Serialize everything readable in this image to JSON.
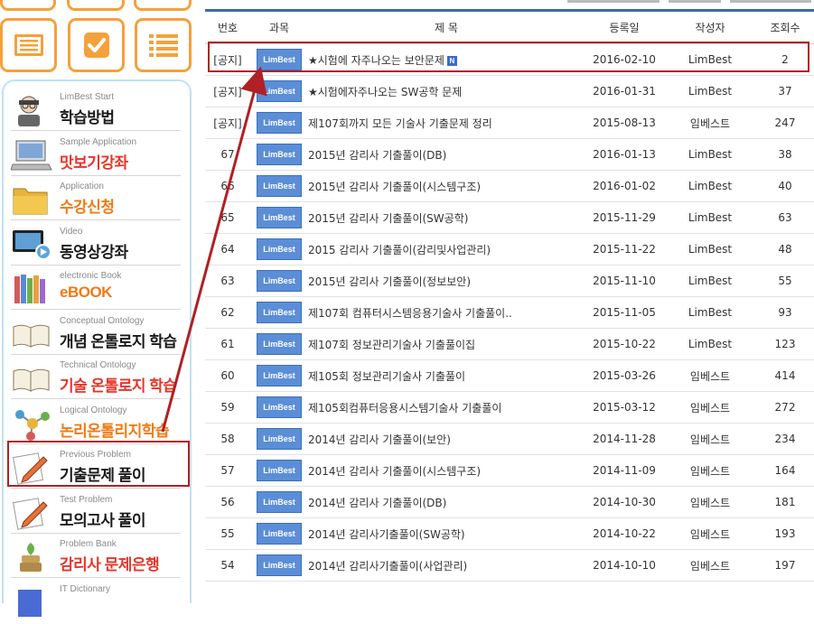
{
  "table": {
    "headers": {
      "num": "번호",
      "subject": "과목",
      "title": "제 목",
      "date": "등록일",
      "author": "작성자",
      "views": "조회수"
    },
    "rows": [
      {
        "num": "[공지]",
        "subject": "LimBest",
        "title": "★시험에 자주나오는 보안문제",
        "is_new": true,
        "new_label": "N",
        "date": "2016-02-10",
        "author": "LimBest",
        "views": "2"
      },
      {
        "num": "[공지]",
        "subject": "LimBest",
        "title": "★시험에자주나오는 SW공학 문제",
        "date": "2016-01-31",
        "author": "LimBest",
        "views": "37"
      },
      {
        "num": "[공지]",
        "subject": "LimBest",
        "title": "제107회까지 모든 기술사 기출문제 정리",
        "date": "2015-08-13",
        "author": "임베스트",
        "views": "247"
      },
      {
        "num": "67",
        "subject": "LimBest",
        "title": "2015년 감리사 기출풀이(DB)",
        "date": "2016-01-13",
        "author": "LimBest",
        "views": "38"
      },
      {
        "num": "66",
        "subject": "LimBest",
        "title": "2015년 감리사 기출풀이(시스템구조)",
        "date": "2016-01-02",
        "author": "LimBest",
        "views": "40"
      },
      {
        "num": "65",
        "subject": "LimBest",
        "title": "2015년 감리사 기출풀이(SW공학)",
        "date": "2015-11-29",
        "author": "LimBest",
        "views": "63"
      },
      {
        "num": "64",
        "subject": "LimBest",
        "title": "2015 감리사 기출풀이(감리및사업관리)",
        "date": "2015-11-22",
        "author": "LimBest",
        "views": "48"
      },
      {
        "num": "63",
        "subject": "LimBest",
        "title": "2015년 감리사 기출풀이(정보보안)",
        "date": "2015-11-10",
        "author": "LimBest",
        "views": "55"
      },
      {
        "num": "62",
        "subject": "LimBest",
        "title": "제107회 컴퓨터시스템응용기술사 기출풀이..",
        "date": "2015-11-05",
        "author": "LimBest",
        "views": "93"
      },
      {
        "num": "61",
        "subject": "LimBest",
        "title": "제107회 정보관리기술사 기출풀이집",
        "date": "2015-10-22",
        "author": "LimBest",
        "views": "123"
      },
      {
        "num": "60",
        "subject": "LimBest",
        "title": "제105회 정보관리기술사 기출풀이",
        "date": "2015-03-26",
        "author": "임베스트",
        "views": "414"
      },
      {
        "num": "59",
        "subject": "LimBest",
        "title": "제105회컴퓨터응용시스템기술사 기출풀이",
        "date": "2015-03-12",
        "author": "임베스트",
        "views": "272"
      },
      {
        "num": "58",
        "subject": "LimBest",
        "title": "2014년 감리사 기출풀이(보안)",
        "date": "2014-11-28",
        "author": "임베스트",
        "views": "234"
      },
      {
        "num": "57",
        "subject": "LimBest",
        "title": "2014년 감리사 기출풀이(시스템구조)",
        "date": "2014-11-09",
        "author": "임베스트",
        "views": "164"
      },
      {
        "num": "56",
        "subject": "LimBest",
        "title": "2014년 감리사 기출풀이(DB)",
        "date": "2014-10-30",
        "author": "임베스트",
        "views": "181"
      },
      {
        "num": "55",
        "subject": "LimBest",
        "title": "2014년 감리사기출풀이(SW공학)",
        "date": "2014-10-22",
        "author": "임베스트",
        "views": "193"
      },
      {
        "num": "54",
        "subject": "LimBest",
        "title": "2014년 감리사기출풀이(사업관리)",
        "date": "2014-10-10",
        "author": "임베스트",
        "views": "197"
      }
    ]
  },
  "sidebar": {
    "items": [
      {
        "sub": "LimBest Start",
        "main": "학습방법",
        "color": "black",
        "icon": "student-icon"
      },
      {
        "sub": "Sample Application",
        "main": "맛보기강좌",
        "color": "red",
        "icon": "laptop-icon"
      },
      {
        "sub": "Application",
        "main": "수강신청",
        "color": "orange",
        "icon": "folder-icon"
      },
      {
        "sub": "Video",
        "main": "동영상강좌",
        "color": "black",
        "icon": "video-screen-icon"
      },
      {
        "sub": "electronic Book",
        "main": "eBOOK",
        "color": "orange",
        "icon": "books-icon"
      },
      {
        "sub": "Conceptual Ontology",
        "main": "개념 온톨로지 학습",
        "color": "black",
        "icon": "open-book-icon"
      },
      {
        "sub": "Technical Ontology",
        "main": "기술 온톨로지 학습",
        "color": "red",
        "icon": "open-book-icon"
      },
      {
        "sub": "Logical Ontology",
        "main": "논리온톨리지학습",
        "color": "orange",
        "icon": "molecule-icon"
      },
      {
        "sub": "Previous Problem",
        "main": "기출문제 풀이",
        "color": "black",
        "icon": "pencil-paper-icon"
      },
      {
        "sub": "Test Problem",
        "main": "모의고사 풀이",
        "color": "black",
        "icon": "pencil-paper-icon"
      },
      {
        "sub": "Problem Bank",
        "main": "감리사 문제은행",
        "color": "red",
        "icon": "coin-stack-icon"
      },
      {
        "sub": "IT Dictionary",
        "main": "",
        "color": "black",
        "icon": "dictionary-icon"
      }
    ]
  },
  "colors": {
    "accent_orange": "#f5a13a",
    "highlight_red": "#b02024",
    "badge_blue": "#5b8ed6",
    "sidebar_border": "#bfe2f5"
  },
  "top_icons": [
    "list-card-icon",
    "checkbox-icon",
    "list-lines-icon"
  ]
}
